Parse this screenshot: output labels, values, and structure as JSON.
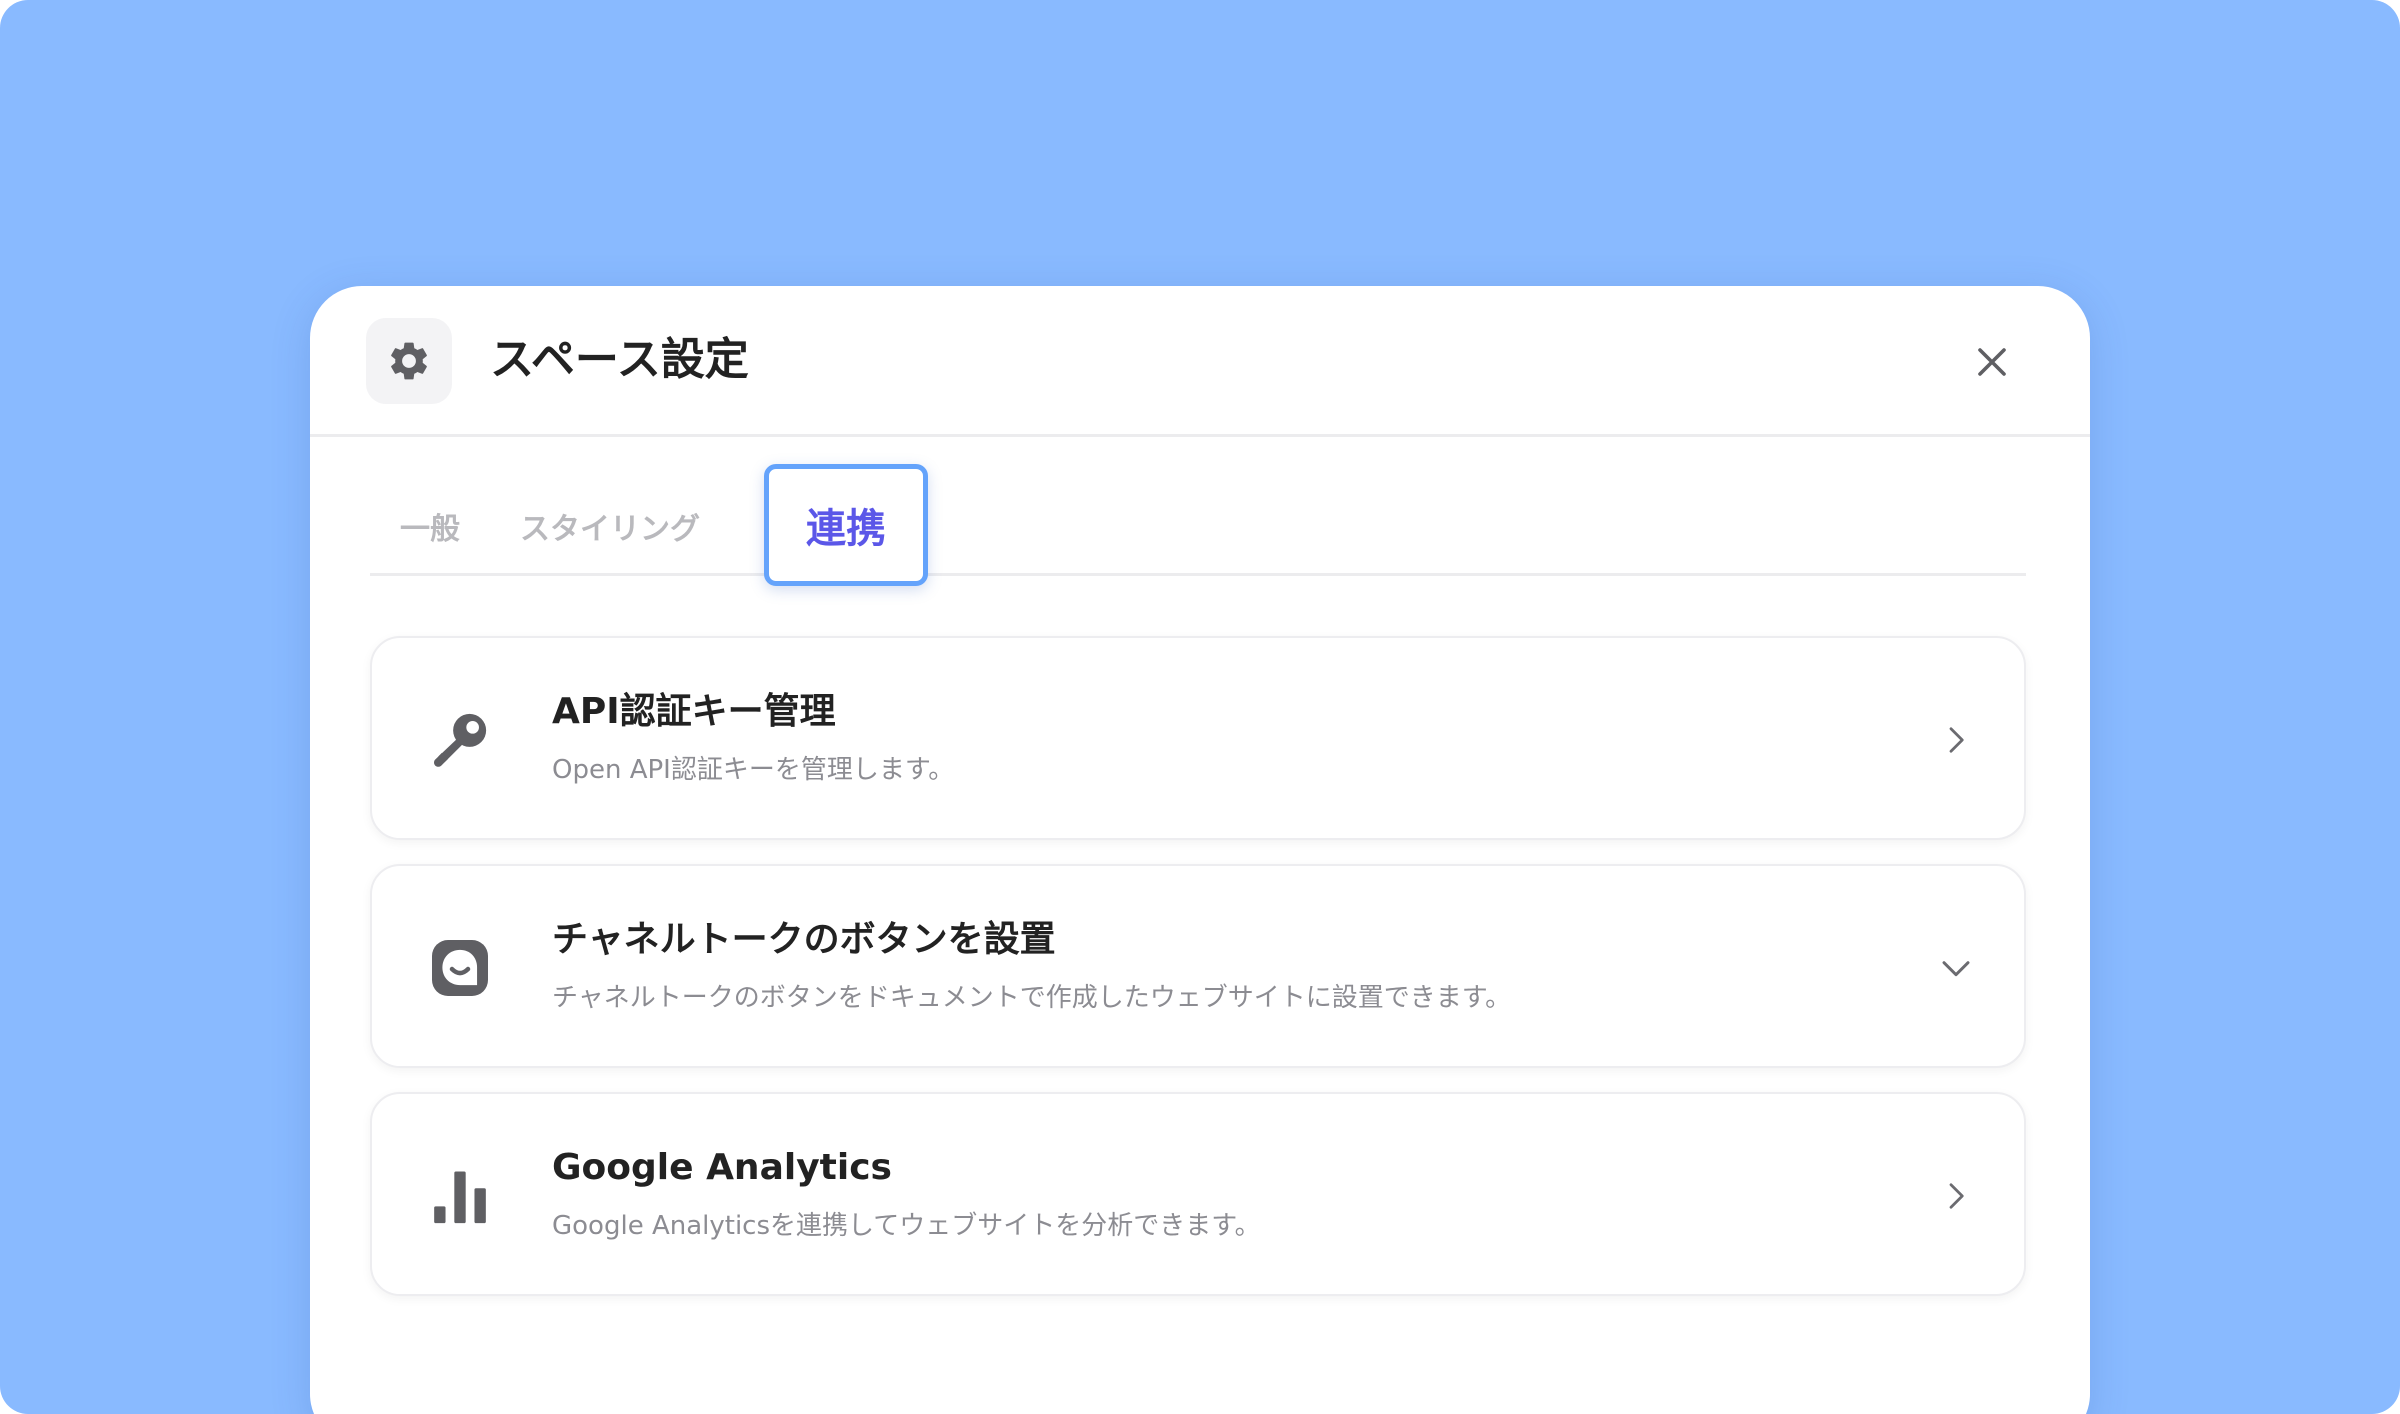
{
  "modal": {
    "title": "スペース設定",
    "header_icon": "gear-icon",
    "close_icon": "close-icon"
  },
  "tabs": [
    {
      "label": "一般",
      "active": false
    },
    {
      "label": "スタイリング",
      "active": false
    },
    {
      "label": "連携",
      "active": true
    }
  ],
  "cards": [
    {
      "icon": "key-icon",
      "title": "API認証キー管理",
      "description": "Open API認証キーを管理します。",
      "chevron": "chevron-right-icon"
    },
    {
      "icon": "channel-talk-icon",
      "title": "チャネルトークのボタンを設置",
      "description": "チャネルトークのボタンをドキュメントで作成したウェブサイトに設置できます。",
      "chevron": "chevron-down-icon"
    },
    {
      "icon": "bar-chart-icon",
      "title": "Google Analytics",
      "description": "Google Analyticsを連携してウェブサイトを分析できます。",
      "chevron": "chevron-right-icon"
    }
  ],
  "colors": {
    "background": "#89baff",
    "active_tab_text": "#5b57e8",
    "active_tab_border": "#64a3fb",
    "icon": "#5f5f63",
    "inactive_tab_text": "#b9b9bd"
  }
}
